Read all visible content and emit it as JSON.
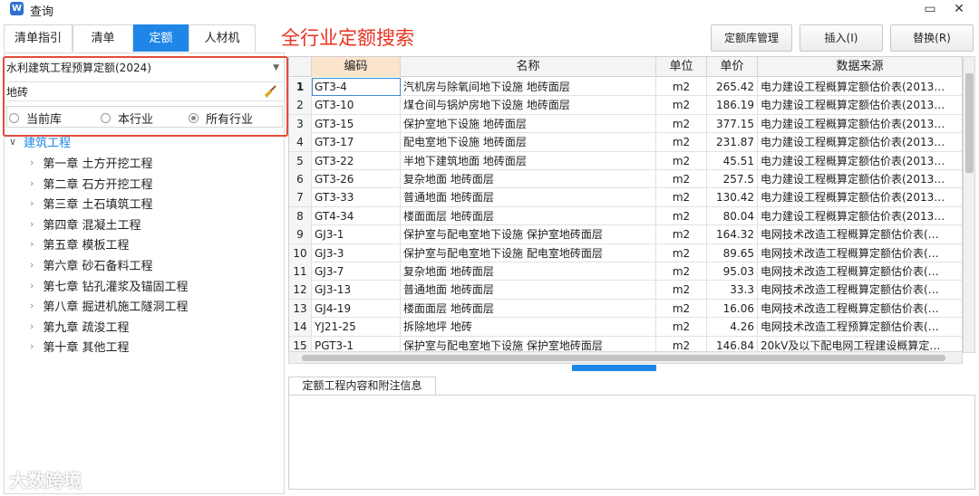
{
  "window": {
    "title": "查询",
    "minimize": "▭",
    "close": "✕"
  },
  "tabs": [
    {
      "label": "清单指引"
    },
    {
      "label": "清单"
    },
    {
      "label": "定额"
    },
    {
      "label": "人材机"
    }
  ],
  "headline": "全行业定额搜索",
  "top_buttons": {
    "manage": "定额库管理",
    "insert": "插入(I)",
    "replace": "替换(R)"
  },
  "left": {
    "library": "水利建筑工程预算定额(2024)",
    "search_value": "地砖",
    "radios": [
      "当前库",
      "本行业",
      "所有行业"
    ],
    "radio_selected": 2,
    "tree_root": "建筑工程",
    "chapters": [
      "第一章 土方开挖工程",
      "第二章 石方开挖工程",
      "第三章 土石填筑工程",
      "第四章 混凝土工程",
      "第五章 模板工程",
      "第六章 砂石备料工程",
      "第七章 钻孔灌浆及锚固工程",
      "第八章 掘进机施工隧洞工程",
      "第九章 疏浚工程",
      "第十章 其他工程"
    ]
  },
  "grid": {
    "headers": [
      "编码",
      "名称",
      "单位",
      "单价",
      "数据来源"
    ],
    "rows": [
      {
        "n": "1",
        "code": "GT3-4",
        "name": "汽机房与除氧间地下设施 地砖面层",
        "unit": "m2",
        "price": "265.42",
        "src": "电力建设工程概算定额估价表(2013…"
      },
      {
        "n": "2",
        "code": "GT3-10",
        "name": "煤仓间与锅炉房地下设施 地砖面层",
        "unit": "m2",
        "price": "186.19",
        "src": "电力建设工程概算定额估价表(2013…"
      },
      {
        "n": "3",
        "code": "GT3-15",
        "name": "保护室地下设施 地砖面层",
        "unit": "m2",
        "price": "377.15",
        "src": "电力建设工程概算定额估价表(2013…"
      },
      {
        "n": "4",
        "code": "GT3-17",
        "name": "配电室地下设施 地砖面层",
        "unit": "m2",
        "price": "231.87",
        "src": "电力建设工程概算定额估价表(2013…"
      },
      {
        "n": "5",
        "code": "GT3-22",
        "name": "半地下建筑地面 地砖面层",
        "unit": "m2",
        "price": "45.51",
        "src": "电力建设工程概算定额估价表(2013…"
      },
      {
        "n": "6",
        "code": "GT3-26",
        "name": "复杂地面 地砖面层",
        "unit": "m2",
        "price": "257.5",
        "src": "电力建设工程概算定额估价表(2013…"
      },
      {
        "n": "7",
        "code": "GT3-33",
        "name": "普通地面 地砖面层",
        "unit": "m2",
        "price": "130.42",
        "src": "电力建设工程概算定额估价表(2013…"
      },
      {
        "n": "8",
        "code": "GT4-34",
        "name": "楼面面层 地砖面层",
        "unit": "m2",
        "price": "80.04",
        "src": "电力建设工程概算定额估价表(2013…"
      },
      {
        "n": "9",
        "code": "GJ3-1",
        "name": "保护室与配电室地下设施 保护室地砖面层",
        "unit": "m2",
        "price": "164.32",
        "src": "电网技术改造工程概算定额估价表(…"
      },
      {
        "n": "10",
        "code": "GJ3-3",
        "name": "保护室与配电室地下设施 配电室地砖面层",
        "unit": "m2",
        "price": "89.65",
        "src": "电网技术改造工程概算定额估价表(…"
      },
      {
        "n": "11",
        "code": "GJ3-7",
        "name": "复杂地面 地砖面层",
        "unit": "m2",
        "price": "95.03",
        "src": "电网技术改造工程概算定额估价表(…"
      },
      {
        "n": "12",
        "code": "GJ3-13",
        "name": "普通地面 地砖面层",
        "unit": "m2",
        "price": "33.3",
        "src": "电网技术改造工程概算定额估价表(…"
      },
      {
        "n": "13",
        "code": "GJ4-19",
        "name": "楼面面层 地砖面层",
        "unit": "m2",
        "price": "16.06",
        "src": "电网技术改造工程概算定额估价表(…"
      },
      {
        "n": "14",
        "code": "YJ21-25",
        "name": "拆除地坪 地砖",
        "unit": "m2",
        "price": "4.26",
        "src": "电网技术改造工程预算定额估价表(…"
      },
      {
        "n": "15",
        "code": "PGT3-1",
        "name": "保护室与配电室地下设施 保护室地砖面层",
        "unit": "m2",
        "price": "146.84",
        "src": "20kV及以下配电网工程建设概算定…"
      }
    ]
  },
  "info_tab": "定额工程内容和附注信息",
  "watermark": "大数跨境",
  "colors": {
    "accent": "#1f86e8",
    "highlight_red": "#e14b3b",
    "code_header": "#fbe4cc"
  }
}
